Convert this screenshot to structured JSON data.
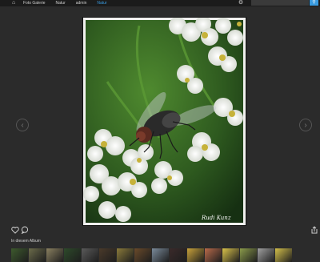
{
  "topbar": {
    "home_icon": "home-icon",
    "crumbs": [
      "Foto Galerie",
      "Natur",
      "admin",
      "Natur"
    ],
    "search_placeholder": "",
    "tools_icon": "tools-icon",
    "search_icon": "search-icon"
  },
  "photo": {
    "watermark": "Rudi Kunz"
  },
  "actions": {
    "like_icon": "heart-icon",
    "comment_icon": "comment-icon",
    "share_icon": "share-icon"
  },
  "album": {
    "label": "In diesem Album",
    "thumb_colors": [
      "#3d5a2d",
      "#6b6b4a",
      "#8a8060",
      "#2d4a2a",
      "#5a5a5a",
      "#4a3a2a",
      "#8a7a3a",
      "#6a4a2a",
      "#7a8a9a",
      "#3a2a2a",
      "#c9a23a",
      "#b86a4a",
      "#d9c24a",
      "#8a9a4a",
      "#a0a0a0",
      "#d4c04a"
    ]
  },
  "colors": {
    "accent": "#3a9be0",
    "background": "#2b2b2b"
  }
}
